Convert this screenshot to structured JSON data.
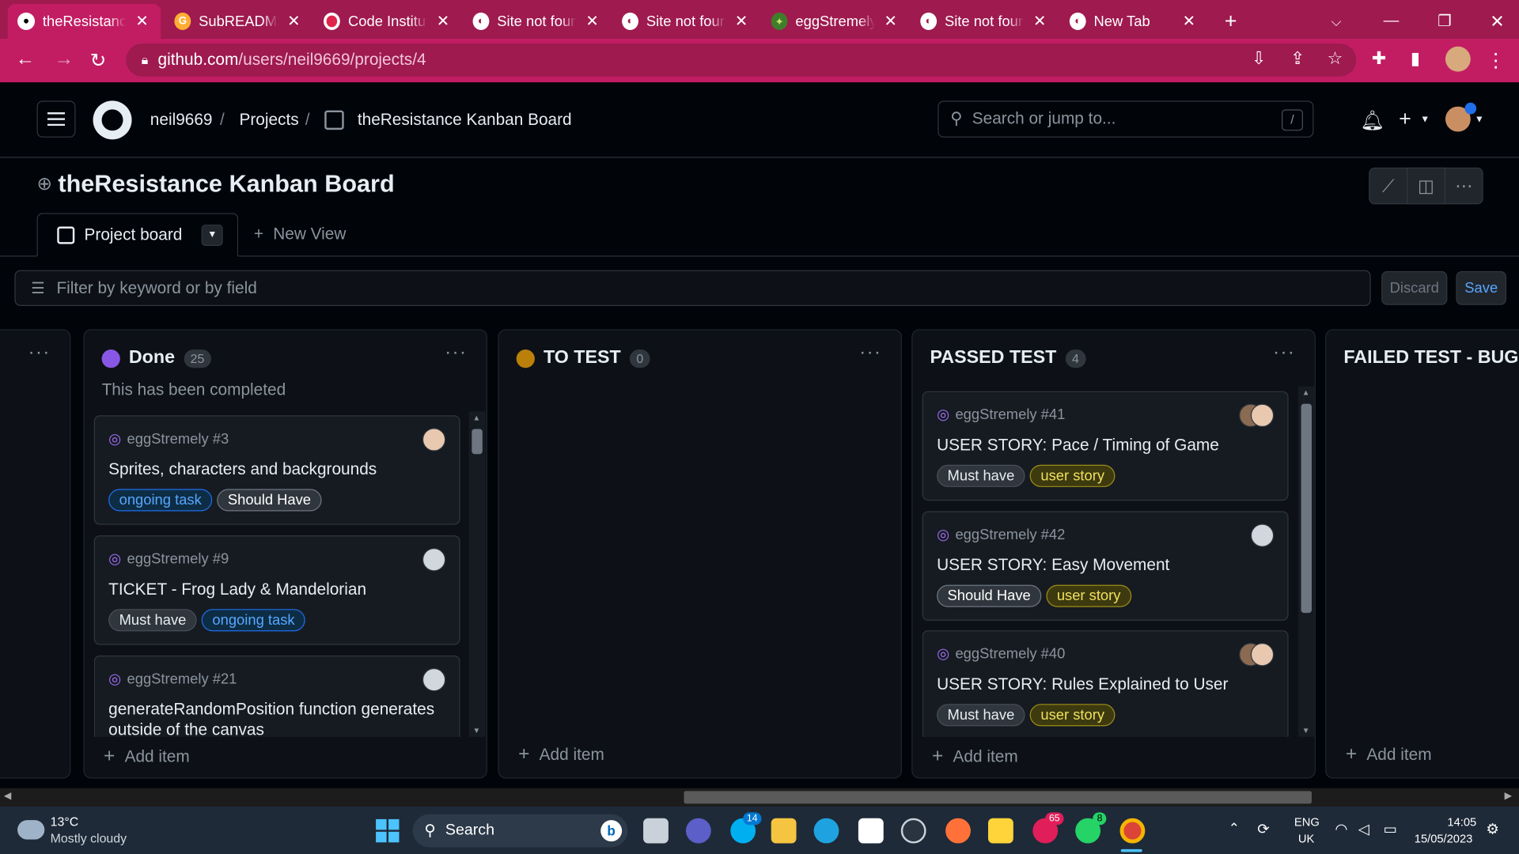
{
  "browser": {
    "tabs": [
      {
        "title": "theResistance",
        "icon": "github-icon",
        "active": true
      },
      {
        "title": "SubREADME",
        "icon": "gitpod-icon"
      },
      {
        "title": "Code Institute",
        "icon": "code-institute-icon"
      },
      {
        "title": "Site not found",
        "icon": "globe-icon"
      },
      {
        "title": "Site not found",
        "icon": "globe-icon"
      },
      {
        "title": "eggStremely",
        "icon": "frog-icon"
      },
      {
        "title": "Site not found",
        "icon": "globe-icon"
      },
      {
        "title": "New Tab",
        "icon": "globe-icon"
      }
    ],
    "close_glyph": "✕",
    "new_tab_glyph": "+",
    "url_host": "github.com",
    "url_path": "/users/neil9669/projects/4"
  },
  "header": {
    "user": "neil9669",
    "projects": "Projects",
    "project_name": "theResistance Kanban Board",
    "search_placeholder": "Search or jump to...",
    "search_shortcut": "/",
    "plus": "+"
  },
  "project": {
    "title": "theResistance Kanban Board",
    "view_tab": "Project board",
    "new_view": "New View",
    "filter_placeholder": "Filter by keyword or by field",
    "discard": "Discard",
    "save": "Save"
  },
  "columns": [
    {
      "name": "Done",
      "count": "25",
      "color": "#8957e5",
      "description": "This has been completed",
      "add_item": "Add item",
      "cards": [
        {
          "ref": "eggStremely #3",
          "title": "Sprites, characters and backgrounds",
          "labels": [
            "ongoing task",
            "Should Have"
          ]
        },
        {
          "ref": "eggStremely #9",
          "title": "TICKET - Frog Lady & Mandelorian",
          "labels": [
            "Must have",
            "ongoing task"
          ]
        },
        {
          "ref": "eggStremely #21",
          "title": "generateRandomPosition function generates outside of the canvas",
          "labels": []
        }
      ]
    },
    {
      "name": "TO TEST",
      "count": "0",
      "color": "#bb8009",
      "add_item": "Add item",
      "cards": []
    },
    {
      "name": "PASSED TEST",
      "count": "4",
      "add_item": "Add item",
      "cards": [
        {
          "ref": "eggStremely #41",
          "title": "USER STORY: Pace / Timing of Game",
          "labels": [
            "Must have",
            "user story"
          ]
        },
        {
          "ref": "eggStremely #42",
          "title": "USER STORY: Easy Movement",
          "labels": [
            "Should Have",
            "user story"
          ]
        },
        {
          "ref": "eggStremely #40",
          "title": "USER STORY: Rules Explained to User",
          "labels": [
            "Must have",
            "user story"
          ]
        }
      ]
    },
    {
      "name": "FAILED TEST - BUG",
      "add_item": "Add item",
      "cards": []
    }
  ],
  "taskbar": {
    "temp": "13°C",
    "weather": "Mostly cloudy",
    "search": "Search",
    "lang1": "ENG",
    "lang2": "UK",
    "time": "14:05",
    "date": "15/05/2023",
    "badge_skype": "14",
    "badge_slack": "65",
    "badge_whatsapp": "8"
  }
}
